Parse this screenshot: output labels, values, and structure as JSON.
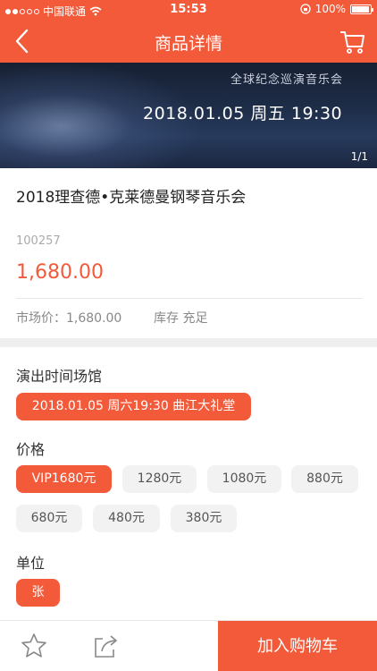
{
  "status_bar": {
    "carrier": "中国联通",
    "time": "15:53",
    "battery": "100%"
  },
  "nav": {
    "title": "商品详情",
    "back_icon": "back-icon",
    "cart_icon": "cart-icon"
  },
  "banner": {
    "subtitle": "全球纪念巡演音乐会",
    "date_line": "2018.01.05 周五 19:30",
    "counter": "1/1"
  },
  "product": {
    "title": "2018理查德•克莱德曼钢琴音乐会",
    "sku": "100257",
    "price": "1,680.00",
    "market_price": "市场价：1,680.00",
    "stock": "库存 充足"
  },
  "venue": {
    "label": "演出时间场馆",
    "option": "2018.01.05 周六19:30 曲江大礼堂"
  },
  "price_options": {
    "label": "价格",
    "items": [
      "VIP1680元",
      "1280元",
      "1080元",
      "880元",
      "680元",
      "480元",
      "380元"
    ]
  },
  "unit": {
    "label": "单位",
    "option": "张"
  },
  "bottom": {
    "favorite_icon": "star-icon",
    "share_icon": "share-icon",
    "add_to_cart": "加入购物车"
  },
  "colors": {
    "accent": "#f25a3a",
    "chip_bg": "#f2f2f2",
    "divider": "#efefef"
  }
}
